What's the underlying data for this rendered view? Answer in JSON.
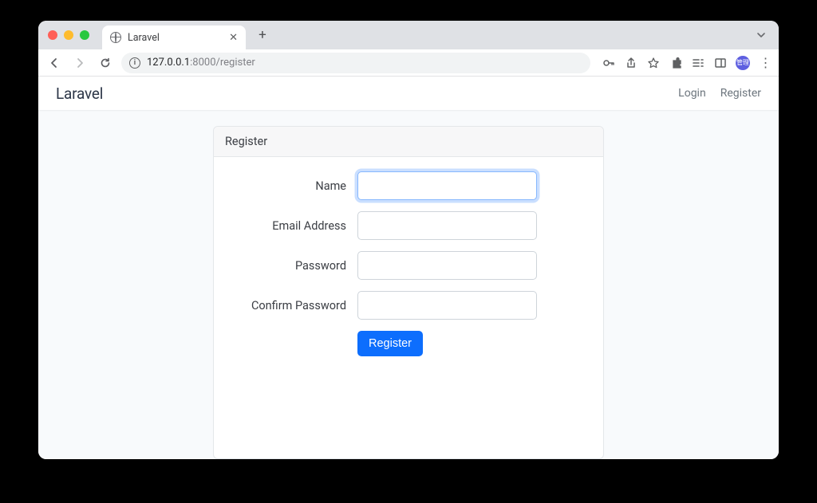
{
  "browser": {
    "tab_title": "Laravel",
    "url_host": "127.0.0.1",
    "url_port": ":8000",
    "url_path": "/register",
    "avatar_label": "管理"
  },
  "navbar": {
    "brand": "Laravel",
    "login_label": "Login",
    "register_label": "Register"
  },
  "card": {
    "header": "Register",
    "fields": {
      "name_label": "Name",
      "email_label": "Email Address",
      "password_label": "Password",
      "confirm_label": "Confirm Password"
    },
    "submit_label": "Register"
  }
}
